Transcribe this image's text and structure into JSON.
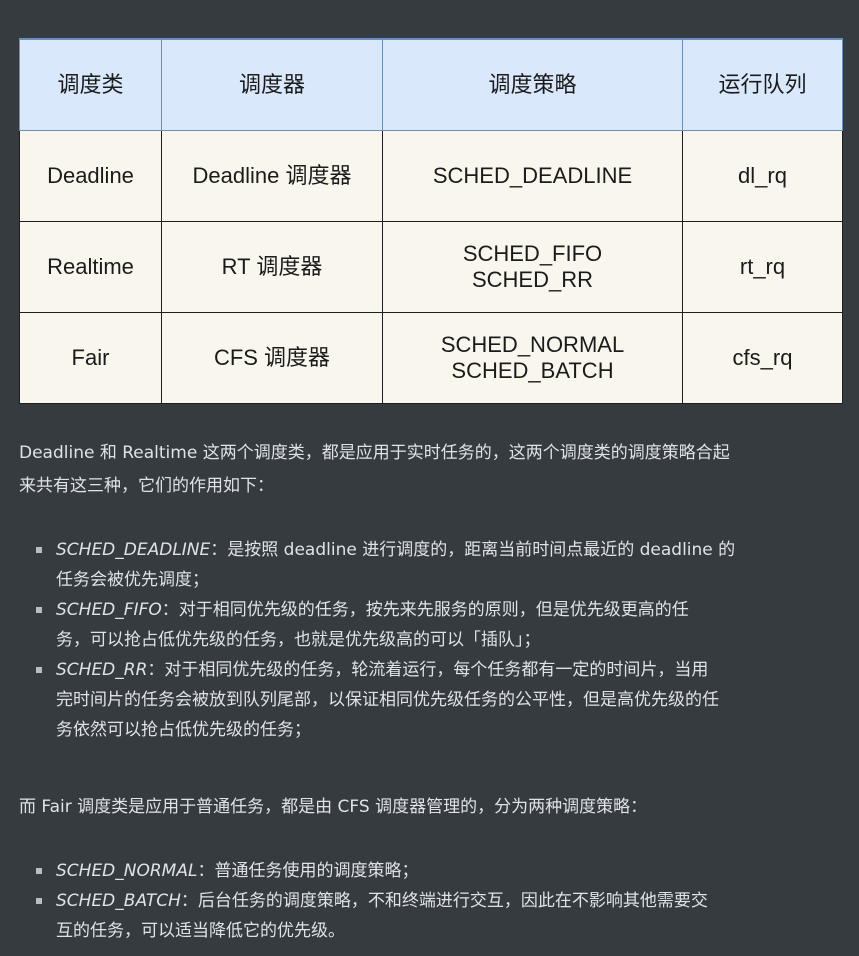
{
  "table": {
    "headers": [
      "调度类",
      "调度器",
      "调度策略",
      "运行队列"
    ],
    "rows": [
      {
        "class": "Deadline",
        "scheduler": "Deadline 调度器",
        "policy": [
          "SCHED_DEADLINE"
        ],
        "queue": "dl_rq"
      },
      {
        "class": "Realtime",
        "scheduler": "RT 调度器",
        "policy": [
          "SCHED_FIFO",
          "SCHED_RR"
        ],
        "queue": "rt_rq"
      },
      {
        "class": "Fair",
        "scheduler": "CFS 调度器",
        "policy": [
          "SCHED_NORMAL",
          "SCHED_BATCH"
        ],
        "queue": "cfs_rq"
      }
    ]
  },
  "intro_paragraph": {
    "line1": "Deadline 和 Realtime 这两个调度类，都是应用于实时任务的，这两个调度类的调度策略合起",
    "line2": "来共有这三种，它们的作用如下："
  },
  "realtime_list": [
    {
      "term": "SCHED_DEADLINE",
      "lines": [
        "：是按照 deadline 进行调度的，距离当前时间点最近的 deadline 的",
        "任务会被优先调度；"
      ]
    },
    {
      "term": "SCHED_FIFO",
      "lines": [
        "：对于相同优先级的任务，按先来先服务的原则，但是优先级更高的任",
        "务，可以抢占低优先级的任务，也就是优先级高的可以「插队」；"
      ]
    },
    {
      "term": "SCHED_RR",
      "lines": [
        "：对于相同优先级的任务，轮流着运行，每个任务都有一定的时间片，当用",
        "完时间片的任务会被放到队列尾部，以保证相同优先级任务的公平性，但是高优先级的任",
        "务依然可以抢占低优先级的任务；"
      ]
    }
  ],
  "fair_paragraph": "而 Fair 调度类是应用于普通任务，都是由 CFS 调度器管理的，分为两种调度策略：",
  "fair_list": [
    {
      "term": "SCHED_NORMAL",
      "lines": [
        "：普通任务使用的调度策略；"
      ]
    },
    {
      "term": "SCHED_BATCH",
      "lines": [
        "：后台任务的调度策略，不和终端进行交互，因此在不影响其他需要交",
        "互的任务，可以适当降低它的优先级。"
      ]
    }
  ]
}
